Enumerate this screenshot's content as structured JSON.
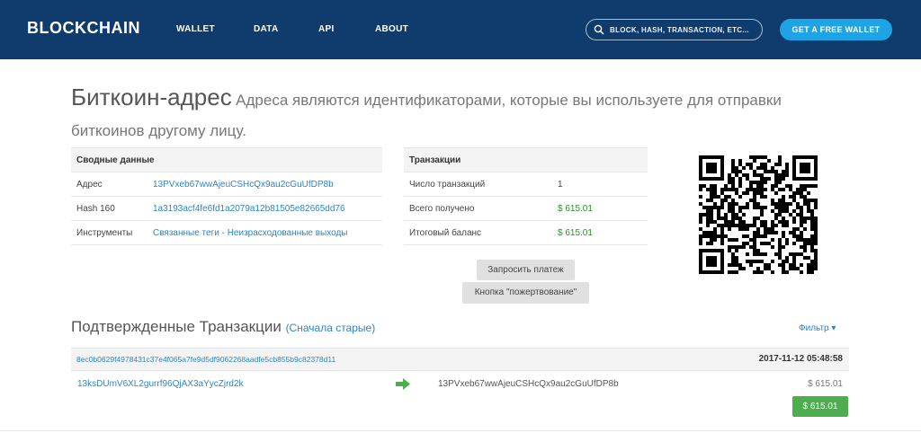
{
  "header": {
    "logo": "BLOCKCHAIN",
    "nav": [
      "WALLET",
      "DATA",
      "API",
      "ABOUT"
    ],
    "search_placeholder": "BLOCK, HASH, TRANSACTION, ETC...",
    "cta": "GET A FREE WALLET"
  },
  "title": {
    "main": "Биткоин-адрес",
    "description": "Адреса являются идентификаторами, которые вы используете для отправки биткоинов другому лицу."
  },
  "summary": {
    "header": "Сводные данные",
    "rows": [
      {
        "label": "Адрес",
        "value": "13PVxeb67wwAjeuCSHcQx9au2cGuUfDP8b"
      },
      {
        "label": "Hash 160",
        "value": "1a3193acf4fe6fd1a2079a12b81505e82665dd76"
      },
      {
        "label": "Инструменты",
        "value": "Связанные теги - Неизрасходованные выходы"
      }
    ]
  },
  "transactions_summary": {
    "header": "Транзакции",
    "rows": [
      {
        "label": "Число транзакций",
        "value": "1"
      },
      {
        "label": "Всего получено",
        "value": "$ 615.01"
      },
      {
        "label": "Итоговый баланс",
        "value": "$ 615.01"
      }
    ]
  },
  "buttons": {
    "request_payment": "Запросить платеж",
    "donation_button": "Кнопка \"пожертвование\""
  },
  "confirmed": {
    "title": "Подтвержденные Транзакции",
    "sort": "(Сначала старые)",
    "filter": "Фильтр ▾",
    "tx": {
      "hash": "8ec0b0629f4978431c37e4f065a7fe9d5df9062268aadfe5cb855b9c82378d11",
      "time": "2017-11-12 05:48:58",
      "from": "13ksDUmV6XL2gurrf96QjAX3aYycZjrd2k",
      "to": "13PVxeb67wwAjeuCSHcQx9au2cGuUfDP8b",
      "amount": "$ 615.01",
      "total": "$ 615.01"
    }
  },
  "colors": {
    "header_bg": "#0f3c6d",
    "cta_bg": "#1ea3e5",
    "link": "#2a86c7",
    "green": "#4cae4c"
  }
}
